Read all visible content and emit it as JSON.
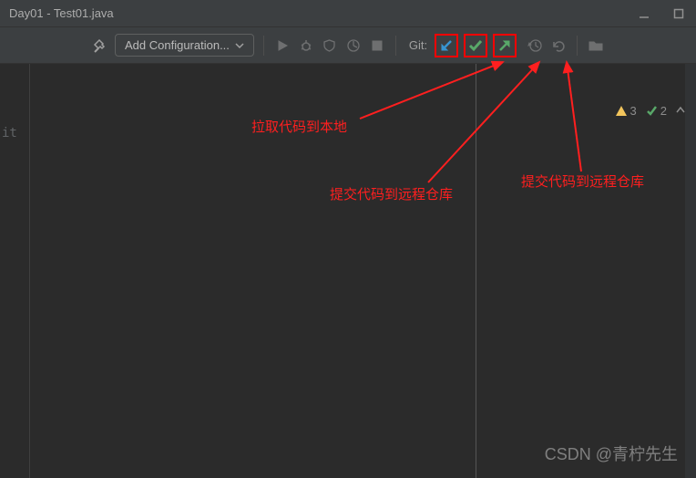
{
  "window": {
    "title": "Day01 - Test01.java"
  },
  "toolbar": {
    "add_config": "Add Configuration...",
    "git_label": "Git:"
  },
  "editor": {
    "partial_text": "it"
  },
  "inspections": {
    "warnings": "3",
    "passes": "2"
  },
  "annotations": {
    "pull_local": "拉取代码到本地",
    "commit_remote": "提交代码到远程仓库",
    "push_remote": "提交代码到远程仓库"
  },
  "watermark": "CSDN @青柠先生"
}
